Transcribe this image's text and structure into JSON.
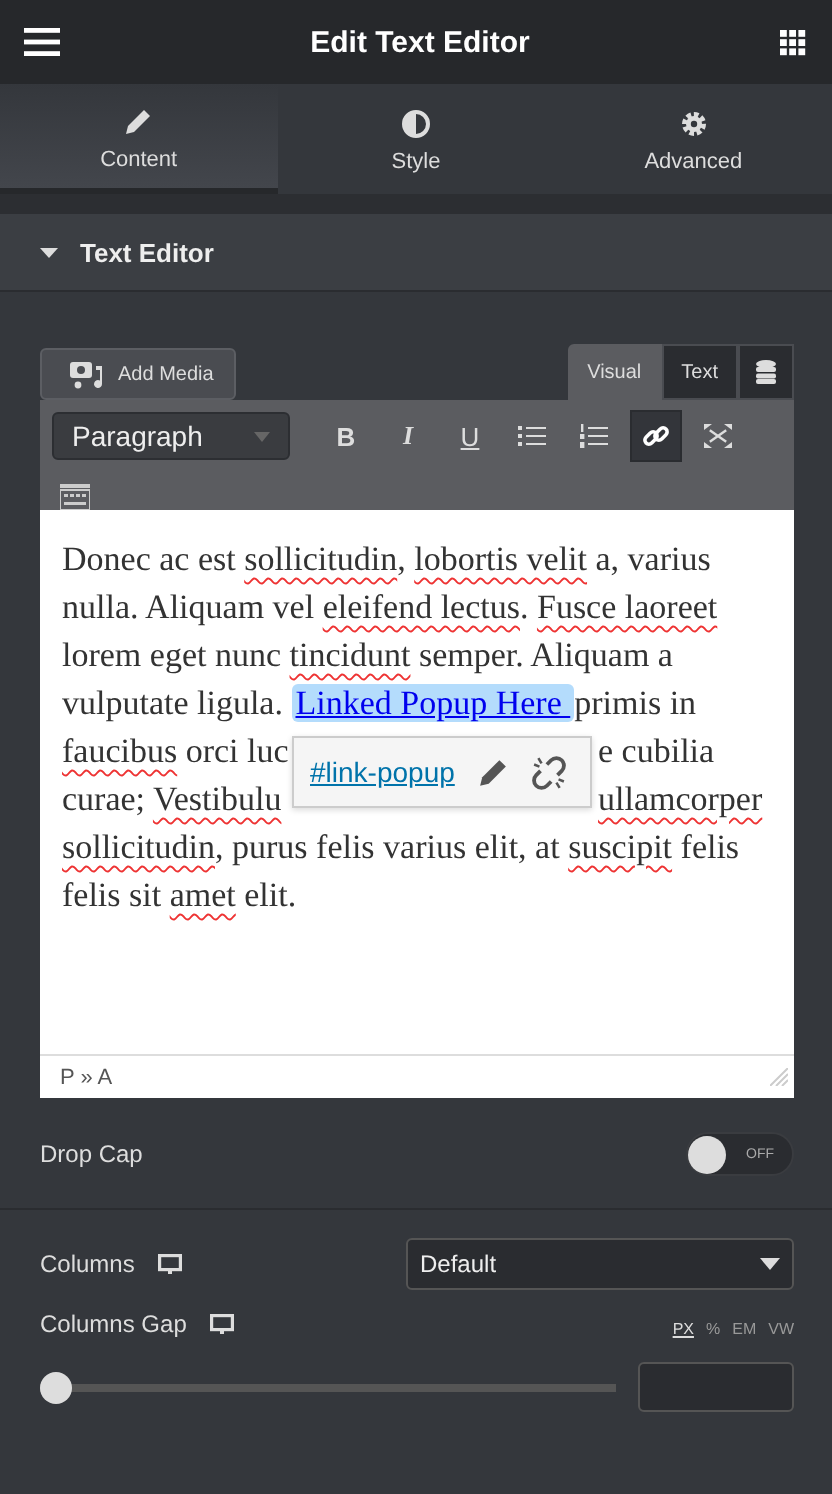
{
  "header": {
    "title": "Edit Text Editor"
  },
  "tabs": [
    {
      "label": "Content",
      "kind": "pencil",
      "selected": true
    },
    {
      "label": "Style",
      "kind": "contrast",
      "selected": false
    },
    {
      "label": "Advanced",
      "kind": "gear",
      "selected": false
    }
  ],
  "section": {
    "title": "Text Editor",
    "expanded": true
  },
  "editor": {
    "add_media": "Add Media",
    "modes": [
      {
        "label": "Visual",
        "selected": true
      },
      {
        "label": "Text",
        "selected": false
      }
    ],
    "format": "Paragraph",
    "toolbar": [
      {
        "kind": "bold",
        "label": "B",
        "active": false
      },
      {
        "kind": "italic",
        "label": "I",
        "active": false
      },
      {
        "kind": "underline",
        "label": "U",
        "active": false
      },
      {
        "kind": "bullets",
        "active": false
      },
      {
        "kind": "numbers",
        "active": false
      },
      {
        "kind": "link",
        "active": true
      },
      {
        "kind": "fullscreen",
        "active": false
      },
      {
        "kind": "keyboard",
        "active": false
      }
    ],
    "lines": [
      {
        "segments": [
          {
            "text": "Donec ac est ",
            "kind": "plain"
          },
          {
            "text": "sollicitudin",
            "kind": "misspelled"
          },
          {
            "text": ", ",
            "kind": "plain"
          },
          {
            "text": "lobortis velit",
            "kind": "misspelled"
          },
          {
            "text": " a, varius",
            "kind": "plain"
          }
        ]
      },
      {
        "segments": [
          {
            "text": "nulla. Aliquam vel ",
            "kind": "plain"
          },
          {
            "text": "eleifend lectus",
            "kind": "misspelled"
          },
          {
            "text": ". ",
            "kind": "plain"
          },
          {
            "text": "Fusce laoreet",
            "kind": "misspelled"
          }
        ]
      },
      {
        "segments": [
          {
            "text": "lorem eget nunc ",
            "kind": "plain"
          },
          {
            "text": "tincidunt",
            "kind": "misspelled"
          },
          {
            "text": " semper. Aliquam a",
            "kind": "plain"
          }
        ]
      },
      {
        "segments": [
          {
            "text": "vulputate ligula. ",
            "kind": "plain"
          },
          {
            "text": "Linked Popup Here ",
            "kind": "link",
            "selected": true
          },
          {
            "text": " primis in",
            "kind": "plain"
          }
        ]
      },
      {
        "segments": [
          {
            "text": "faucibus",
            "kind": "misspelled"
          },
          {
            "text": " orci luc",
            "kind": "plain"
          }
        ],
        "popup": true,
        "after": [
          {
            "text": "e cubilia",
            "kind": "plain"
          }
        ]
      },
      {
        "segments": [
          {
            "text": "curae; ",
            "kind": "plain"
          },
          {
            "text": "Vestibulu",
            "kind": "misspelled"
          }
        ],
        "after": [
          {
            "text": "ullamcorper",
            "kind": "misspelled"
          }
        ]
      },
      {
        "segments": [
          {
            "text": "sollicitudin",
            "kind": "misspelled"
          },
          {
            "text": ", purus felis varius elit, at ",
            "kind": "plain"
          },
          {
            "text": "suscipit",
            "kind": "misspelled"
          },
          {
            "text": " felis",
            "kind": "plain"
          }
        ]
      },
      {
        "segments": [
          {
            "text": "felis sit ",
            "kind": "plain"
          },
          {
            "text": "amet",
            "kind": "misspelled"
          },
          {
            "text": " elit.",
            "kind": "plain"
          }
        ]
      }
    ],
    "link_popup": {
      "url": "#link-popup"
    },
    "path": "P » A"
  },
  "drop_cap": {
    "label": "Drop Cap",
    "on": false,
    "state_text": "OFF"
  },
  "columns": {
    "label": "Columns",
    "value": "Default"
  },
  "columns_gap": {
    "label": "Columns Gap",
    "units": [
      {
        "label": "PX",
        "selected": true
      },
      {
        "label": "%",
        "selected": false
      },
      {
        "label": "EM",
        "selected": false
      },
      {
        "label": "VW",
        "selected": false
      }
    ],
    "level": 0
  }
}
